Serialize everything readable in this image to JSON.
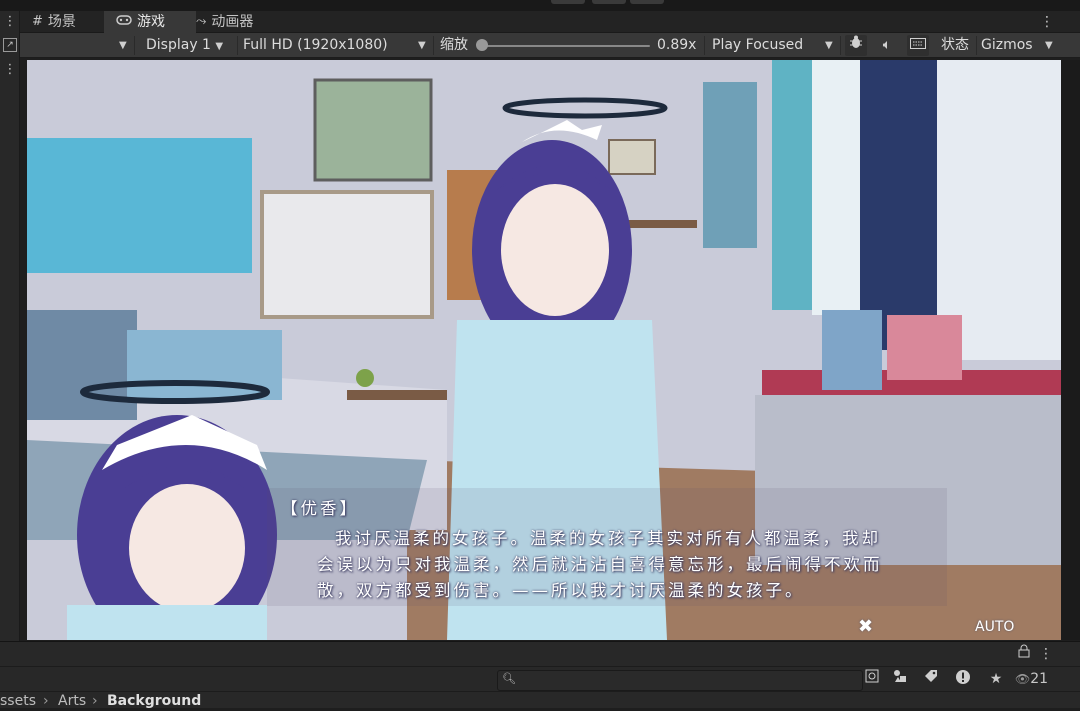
{
  "tabs": [
    {
      "label": "场景",
      "icon": "grid-icon"
    },
    {
      "label": "游戏",
      "icon": "gamepad-icon"
    },
    {
      "label": "动画器",
      "icon": "animator-icon"
    }
  ],
  "toolbar": {
    "display": "Display 1",
    "resolution": "Full HD (1920x1080)",
    "scale_label": "缩放",
    "scale_value": "0.89x",
    "scale_fraction": 0.0,
    "play_mode": "Play Focused",
    "stats_label": "状态",
    "gizmos_label": "Gizmos"
  },
  "dialogue": {
    "speaker": "【优香】",
    "line1": "我讨厌温柔的女孩子。温柔的女孩子其实对所有人都温柔，我却",
    "line2": "会误以为只对我温柔，然后就沾沾自喜得意忘形，最后闹得不欢而",
    "line3": "散，双方都受到伤害。——所以我才讨厌温柔的女孩子。",
    "close_icon": "close-icon",
    "auto_label": "AUTO"
  },
  "project": {
    "search_value": "",
    "count": "21",
    "breadcrumb": [
      "ssets",
      "Arts",
      "Background"
    ]
  },
  "colors": {
    "editor_bg": "#1e1e1e",
    "toolbar_bg": "#383838",
    "panel_bg": "#282828",
    "dialogue_text": "#ffffff"
  }
}
